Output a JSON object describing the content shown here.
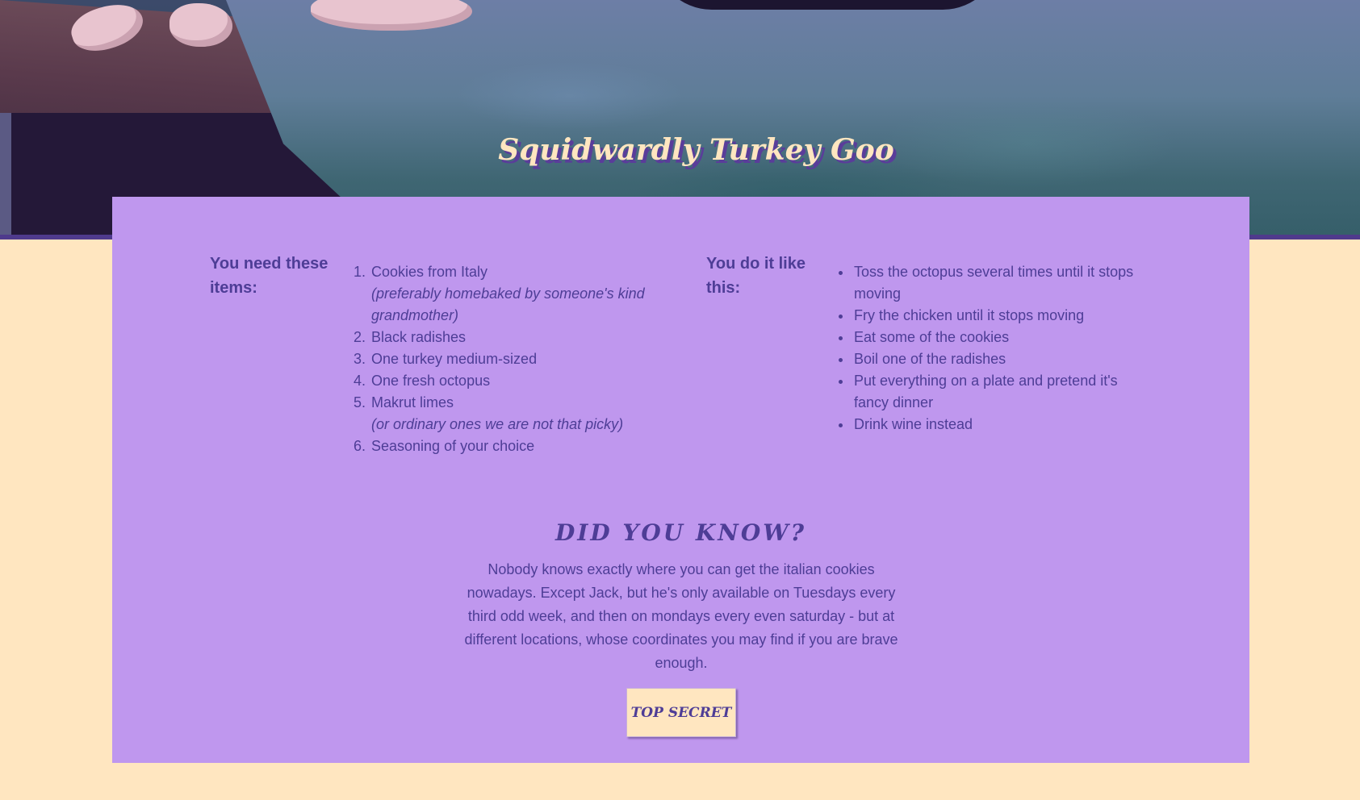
{
  "hero": {
    "title": "Squidwardly Turkey Goo"
  },
  "ingredients": {
    "heading": "You need these items:",
    "items": [
      {
        "text": "Cookies from Italy",
        "note": "(preferably homebaked by someone's kind grandmother)"
      },
      {
        "text": "Black radishes",
        "note": ""
      },
      {
        "text": "One turkey medium-sized",
        "note": ""
      },
      {
        "text": "One fresh octopus",
        "note": ""
      },
      {
        "text": "Makrut limes",
        "note": "(or ordinary ones we are not that picky)"
      },
      {
        "text": "Seasoning of your choice",
        "note": ""
      }
    ]
  },
  "steps": {
    "heading": "You do it like this:",
    "items": [
      "Toss the octopus several times until it stops moving",
      "Fry the chicken until it stops moving",
      "Eat some of the cookies",
      "Boil one of the radishes",
      "Put everything on a plate and pretend it's fancy dinner",
      "Drink wine instead"
    ]
  },
  "did_you_know": {
    "title": "DID YOU KNOW?",
    "text": "Nobody knows exactly where you can get the italian cookies nowadays. Except Jack, but he's only available on Tuesdays every third odd week, and then on mondays every even saturday - but at different locations, whose coordinates you may find if you are brave enough.",
    "button_label": "TOP SECRET"
  },
  "colors": {
    "page_background": "#ffe6c0",
    "card_background": "#bf97ee",
    "text": "#4e3d96",
    "title_cream": "#ffe6c0"
  }
}
